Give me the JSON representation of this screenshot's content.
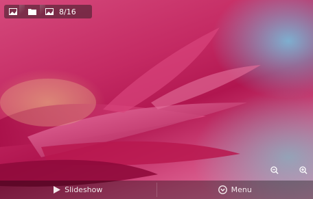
{
  "viewer": {
    "breadcrumbs": [
      {
        "icon": "gallery-icon"
      },
      {
        "icon": "folder-icon"
      },
      {
        "icon": "image-icon"
      }
    ],
    "counter": "8/16",
    "zoom_out_icon": "zoom-out-icon",
    "zoom_in_icon": "zoom-in-icon"
  },
  "bottom_bar": {
    "slideshow_label": "Slideshow",
    "menu_label": "Menu",
    "slideshow_icon": "play-icon",
    "menu_icon": "menu-circle-icon"
  },
  "colors": {
    "petal": "#c42a63",
    "background_blue": "#78bedc",
    "text": "#ffffff"
  }
}
